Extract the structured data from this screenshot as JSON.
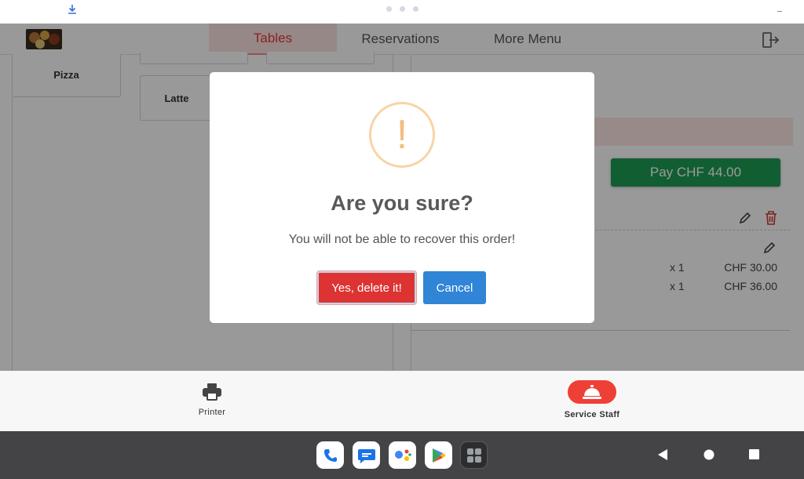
{
  "nav": {
    "tabs": [
      {
        "label": "Tables",
        "active": true
      },
      {
        "label": "Reservations",
        "active": false
      },
      {
        "label": "More Menu",
        "active": false
      }
    ]
  },
  "products": [
    {
      "label": "Pizza"
    },
    {
      "label": "Latte"
    }
  ],
  "order": {
    "pay_label": "Pay CHF 44.00",
    "items": [
      {
        "qty": "x 1",
        "price": "CHF 30.00"
      },
      {
        "qty": "x 1",
        "price": "CHF 36.00"
      }
    ]
  },
  "dialog": {
    "icon_glyph": "!",
    "title": "Are you sure?",
    "message": "You will not be able to recover this order!",
    "confirm_label": "Yes, delete it!",
    "cancel_label": "Cancel"
  },
  "bottom_bar": {
    "printer_label": "Printer",
    "service_staff_label": "Service Staff"
  },
  "colors": {
    "accent_red": "#ef4035",
    "pay_green": "#1f9d55",
    "confirm_red": "#dd3333",
    "cancel_blue": "#3085d6",
    "warning_orange": "#f8bb86"
  }
}
